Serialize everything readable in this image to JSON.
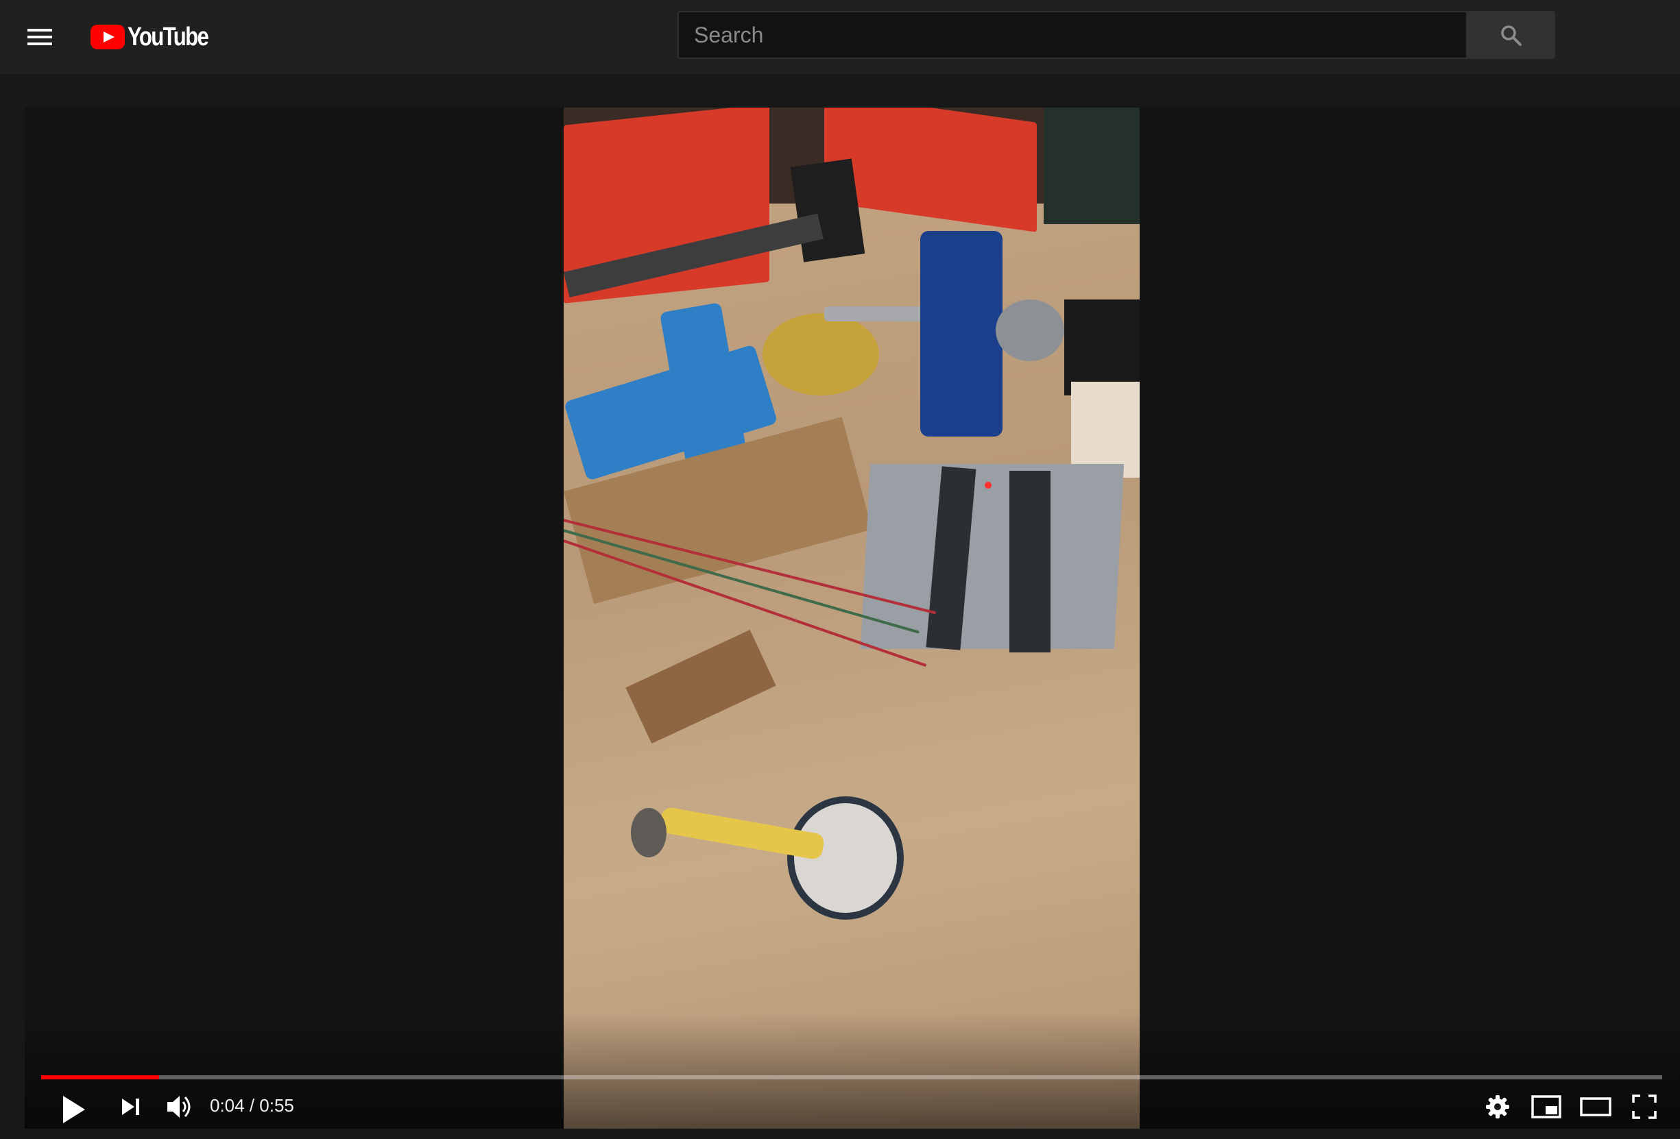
{
  "header": {
    "menu_icon": "hamburger-menu-icon",
    "logo_text": "YouTube",
    "search": {
      "placeholder": "Search",
      "value": "",
      "button_icon": "search-icon"
    }
  },
  "player": {
    "current_time": "0:04",
    "separator": " / ",
    "duration": "0:55",
    "progress_fraction": 0.0727,
    "controls_left": [
      "play-icon",
      "next-icon",
      "volume-icon"
    ],
    "controls_right": [
      "settings-gear-icon",
      "miniplayer-icon",
      "theater-mode-icon",
      "fullscreen-icon"
    ],
    "progress_color": "#ff0000"
  },
  "colors": {
    "topbar_bg": "#202020",
    "page_bg": "#181818",
    "brand_red": "#ff0000"
  }
}
